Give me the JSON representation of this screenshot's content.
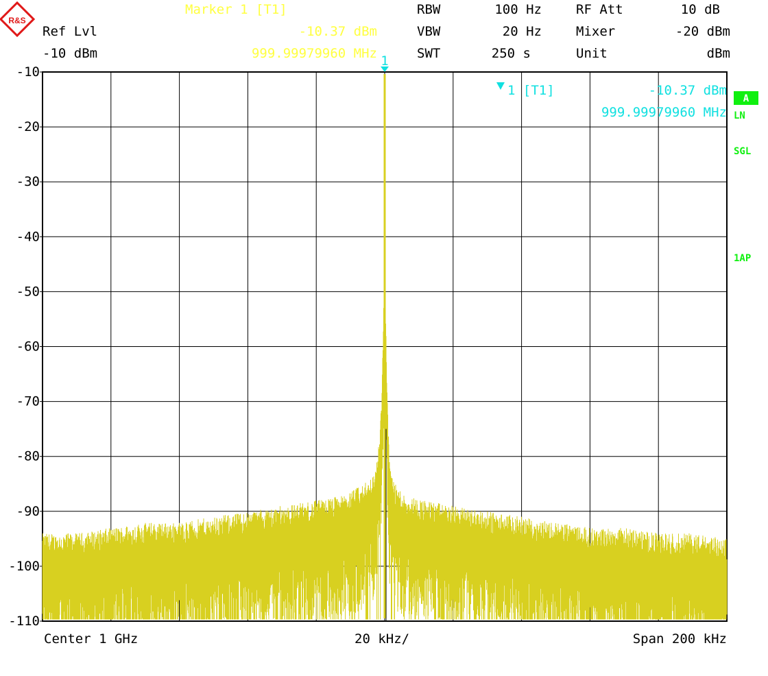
{
  "colors": {
    "trace": "#d8d020",
    "marker_text": "#ffff40",
    "marker": "#10e0e0",
    "grid": "#000000",
    "text": "#000000",
    "status_green": "#10f010",
    "logo_red": "#e01818"
  },
  "header": {
    "logo_icon": "rohde-schwarz-logo",
    "logo_text": "R&S",
    "ref_lvl_label": "Ref Lvl",
    "ref_lvl_value": "-10 dBm",
    "marker_title": "Marker 1 [T1]",
    "marker_level": "-10.37 dBm",
    "marker_freq": "999.99979960 MHz",
    "rbw_label": "RBW",
    "rbw_value": "100 Hz",
    "vbw_label": "VBW",
    "vbw_value": "20 Hz",
    "swt_label": "SWT",
    "swt_value": "250 s",
    "rf_att_label": "RF Att",
    "rf_att_value": "10 dB",
    "mixer_label": "Mixer",
    "mixer_value": "-20 dBm",
    "unit_label": "Unit",
    "unit_value": "dBm"
  },
  "marker_box": {
    "icon": "marker-triangle-icon",
    "label": "1 [T1]",
    "level": "-10.37 dBm",
    "freq": "999.99979960 MHz",
    "flag": "1"
  },
  "side_labels": {
    "a": "A",
    "ln": "LN",
    "sgl": "SGL",
    "ap": "1AP"
  },
  "footer": {
    "center": "Center 1 GHz",
    "div": "20 kHz/",
    "span": "Span 200 kHz"
  },
  "chart_data": {
    "type": "line",
    "x_unit": "kHz offset from center",
    "xlim": [
      -100,
      100
    ],
    "ylim": [
      -110,
      -10
    ],
    "yticks": [
      "-10",
      "-20",
      "-30",
      "-40",
      "-50",
      "-60",
      "-70",
      "-80",
      "-90",
      "-100",
      "-110"
    ],
    "grid": true,
    "series": [
      {
        "x": [
          -100,
          -90,
          -80,
          -70,
          -60,
          -50,
          -40,
          -30,
          -20,
          -12,
          -6,
          -3,
          -1.5,
          -0.8,
          -0.3,
          0,
          0.3,
          0.8,
          1.5,
          3,
          6,
          12,
          20,
          30,
          40,
          50,
          60,
          70,
          80,
          90,
          100
        ],
        "values": [
          -97,
          -97,
          -96,
          -95,
          -95,
          -94,
          -93,
          -92,
          -91,
          -90,
          -88,
          -86,
          -80,
          -70,
          -55,
          -10.37,
          -58,
          -72,
          -85,
          -88,
          -90,
          -91,
          -92,
          -93,
          -94,
          -95,
          -96,
          -96,
          -97,
          -97,
          -98
        ]
      }
    ],
    "marker": {
      "x": -0.0002,
      "y": -10.37
    }
  }
}
